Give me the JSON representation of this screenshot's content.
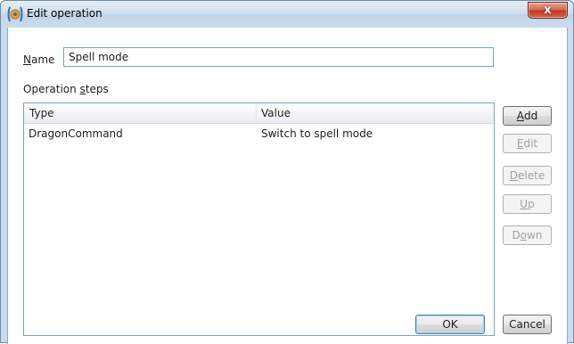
{
  "window": {
    "title": "Edit operation",
    "close_glyph": "x"
  },
  "form": {
    "name_label_mnemonic": "N",
    "name_label_rest": "ame",
    "name_value": "Spell mode",
    "steps_label_prefix": "Operation ",
    "steps_label_mnemonic": "s",
    "steps_label_rest": "teps"
  },
  "grid": {
    "columns": [
      "Type",
      "Value"
    ],
    "rows": [
      {
        "type": "DragonCommand",
        "value": "Switch to spell mode"
      }
    ]
  },
  "side_buttons": {
    "add": {
      "mnemonic": "A",
      "rest": "dd",
      "enabled": true
    },
    "edit": {
      "mnemonic": "E",
      "rest": "dit",
      "enabled": false
    },
    "delete": {
      "mnemonic": "D",
      "rest": "elete",
      "enabled": false
    },
    "up": {
      "mnemonic": "U",
      "rest": "p",
      "enabled": false
    },
    "down": {
      "prefix": "D",
      "mnemonic": "o",
      "rest": "wn",
      "enabled": false
    }
  },
  "footer": {
    "ok_label": "OK",
    "cancel_label": "Cancel"
  },
  "icons": {
    "app": "voice-command-icon",
    "close": "close-icon"
  },
  "colors": {
    "titlebar": "#cfdeee",
    "close_button": "#c0391e",
    "grid_border": "#82a0c0",
    "disabled_text": "#a0a0a0"
  }
}
